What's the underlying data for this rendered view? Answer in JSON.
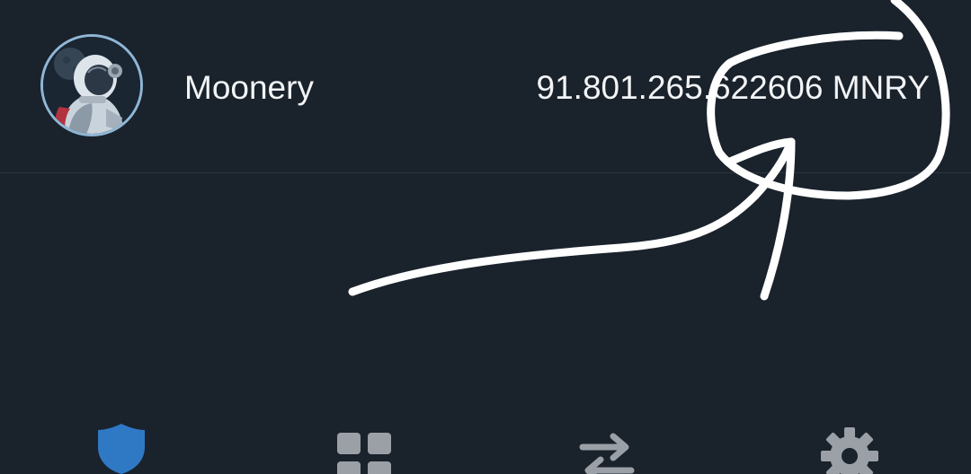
{
  "token": {
    "name": "Moonery",
    "balance": "91.801.265.622606 MNRY"
  },
  "bottom_nav": {
    "items": [
      {
        "icon": "shield-icon",
        "active": true,
        "color": "#2f78c4"
      },
      {
        "icon": "dashboard-grid-icon",
        "active": false,
        "color": "#9aa0a6"
      },
      {
        "icon": "swap-arrows-icon",
        "active": false,
        "color": "#9aa0a6"
      },
      {
        "icon": "gear-icon",
        "active": false,
        "color": "#9aa0a6"
      }
    ]
  },
  "colors": {
    "background": "#1a222c",
    "text": "#f2f4f6",
    "accent": "#2f78c4",
    "avatar_ring": "#8fb7d6",
    "annotation": "#ffffff"
  }
}
